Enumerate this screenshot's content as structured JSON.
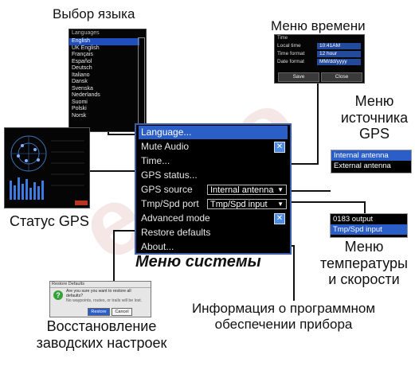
{
  "captions": {
    "language_select": "Выбор языка",
    "time_menu": "Меню времени",
    "gps_source_menu_l1": "Меню",
    "gps_source_menu_l2": "источника",
    "gps_source_menu_l3": "GPS",
    "gps_status": "Статус GPS",
    "system_menu": "Меню системы",
    "temp_speed_l1": "Меню",
    "temp_speed_l2": "температуры",
    "temp_speed_l3": "и скорости",
    "software_info_l1": "Информация о программном",
    "software_info_l2": "обеспечении прибора",
    "restore_l1": "Восстановление",
    "restore_l2": "заводских настроек"
  },
  "language_menu": {
    "title": "Languages",
    "items": [
      "English",
      "UK English",
      "Français",
      "Español",
      "Deutsch",
      "Italiano",
      "Dansk",
      "Svenska",
      "Nederlands",
      "Suomi",
      "Polski",
      "Norsk"
    ],
    "selected_index": 0
  },
  "time_menu": {
    "title": "Time",
    "rows": [
      {
        "label": "Local time",
        "value": "10:41AM"
      },
      {
        "label": "Time format",
        "value": "12 hour"
      },
      {
        "label": "Date format",
        "value": "MM/dd/yyyy"
      }
    ],
    "save_label": "Save",
    "close_label": "Close"
  },
  "system_menu": {
    "items": {
      "language": "Language...",
      "mute_audio": "Mute Audio",
      "time": "Time...",
      "gps_status": "GPS status...",
      "gps_source": "GPS source",
      "tmp_spd_port": "Tmp/Spd port",
      "advanced_mode": "Advanced mode",
      "restore_defaults": "Restore defaults",
      "about": "About..."
    },
    "gps_source_value": "Internal antenna",
    "tmp_spd_value": "Tmp/Spd input",
    "mute_audio_checked": "✕",
    "advanced_mode_checked": "✕",
    "highlight_color": "#2b5ec7"
  },
  "gps_source_list": {
    "items": [
      "Internal antenna",
      "External antenna"
    ],
    "selected_index": 0
  },
  "tmp_spd_list": {
    "items": [
      "0183 output",
      "Tmp/Spd input"
    ],
    "selected_index": 1
  },
  "restore_dialog": {
    "title": "Restore Defaults",
    "question": "Are you sure you want to restore all defaults?",
    "note": "No waypoints, routes, or trails will be lost.",
    "restore_label": "Restore",
    "cancel_label": "Cancel"
  }
}
